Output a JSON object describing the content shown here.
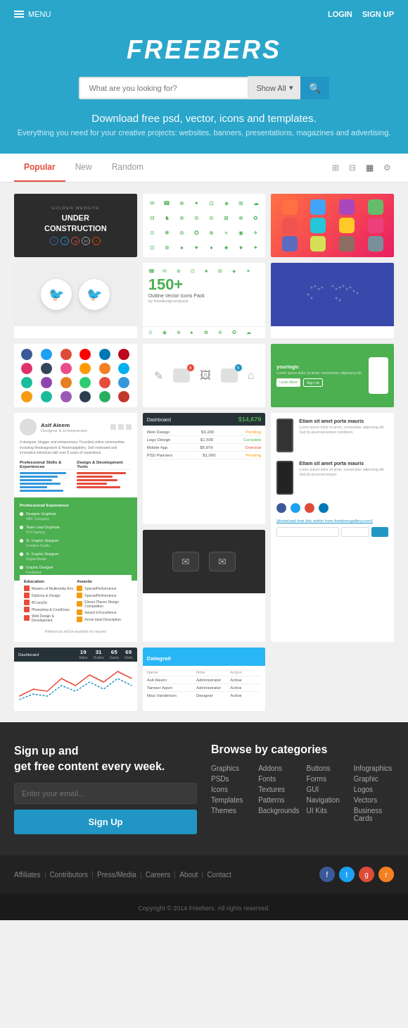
{
  "header": {
    "menu_label": "MENU",
    "login_label": "LOGIN",
    "signup_label": "SIGN UP"
  },
  "hero": {
    "title": "FREEBERS",
    "search_placeholder": "What are you looking for?",
    "search_filter": "Show All",
    "tagline": "Download free psd, vector, icons and templates.",
    "sub": "Everything you need for your creative projects: websites, banners, presentations, magazines and advertising."
  },
  "tabs": {
    "items": [
      {
        "label": "Popular",
        "active": true
      },
      {
        "label": "New",
        "active": false
      },
      {
        "label": "Random",
        "active": false
      }
    ]
  },
  "cards": {
    "under_construction": {
      "small_text": "GOLDEN WEBSITE",
      "title": "UNDER\nCONSTRUCTION"
    },
    "icons_pack": {
      "count": "150+",
      "label": "Outline Vector Icons Pack",
      "sub": "by freedesignerspack"
    },
    "resume_name": "Asif Aleem",
    "resume_role": "Designer & Entrepreneur",
    "dashboard_amount": "$14,679",
    "mobile_app_title": "yourlogic",
    "mobile_app_desc": "Lorem ipsum dolor sit amet, consectetur adipiscing elit"
  },
  "footer_cta": {
    "title": "Sign up and\nget free content every week.",
    "email_placeholder": "Enter your email...",
    "button_label": "Sign Up",
    "browse_title": "Browse by categories",
    "categories": [
      "Graphics",
      "Addons",
      "Buttons",
      "Infographics",
      "PSDs",
      "Fonts",
      "Forms",
      "Graphic",
      "Icons",
      "Textures",
      "GUI",
      "Logos",
      "Templates",
      "Patterns",
      "Navigation",
      "Vectors",
      "Themes",
      "Backgrounds",
      "UI Kits",
      "Business Cards"
    ]
  },
  "footer_nav": {
    "links": [
      "Affiliates",
      "Contributors",
      "Press/Media",
      "Careers",
      "About",
      "Contact"
    ],
    "copyright": "Copyright © 2014 Freebers. All rights reserved."
  }
}
